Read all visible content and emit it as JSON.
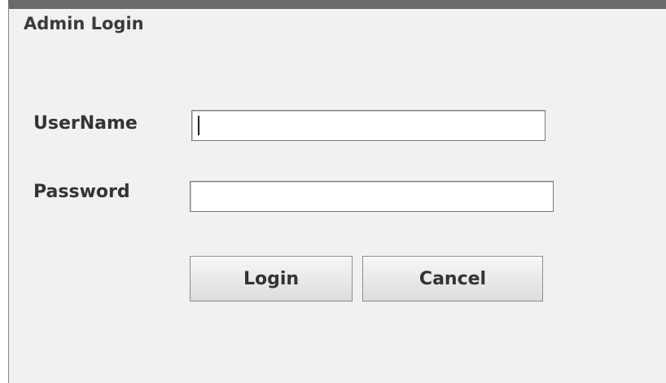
{
  "window": {
    "title": "Admin Login"
  },
  "form": {
    "username_label": "UserName",
    "username_value": "",
    "password_label": "Password",
    "password_value": ""
  },
  "buttons": {
    "login_label": "Login",
    "cancel_label": "Cancel"
  }
}
